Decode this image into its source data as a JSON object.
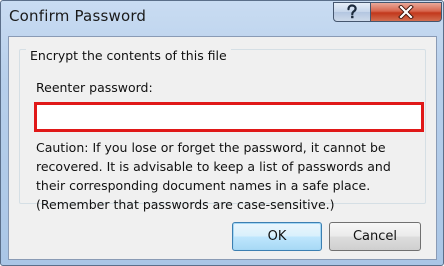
{
  "window": {
    "title": "Confirm Password",
    "help_icon": "question-mark-icon",
    "close_icon": "close-x-icon",
    "colors": {
      "close_button": "#c2381c",
      "highlight_border": "#e01818",
      "default_button_border": "#3c7fb1"
    }
  },
  "group": {
    "label": "Encrypt the contents of this file"
  },
  "password": {
    "label": "Reenter password:",
    "value": "",
    "placeholder": ""
  },
  "caution": {
    "text": "Caution: If you lose or forget the password, it cannot be\nrecovered. It is advisable to keep a list of passwords and\ntheir corresponding document names in a safe place.\n(Remember that passwords are case-sensitive.)"
  },
  "buttons": {
    "ok_label": "OK",
    "cancel_label": "Cancel"
  }
}
